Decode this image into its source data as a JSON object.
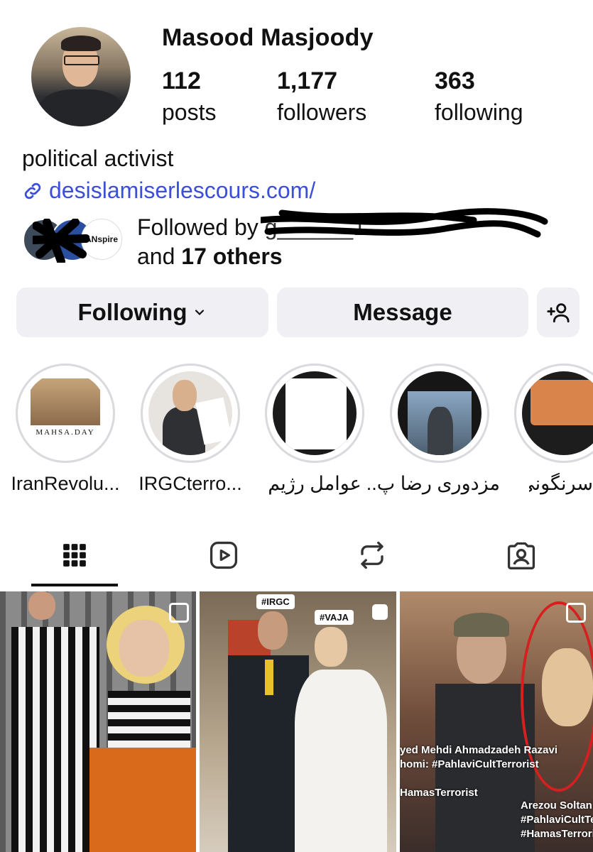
{
  "profile": {
    "name": "Masood Masjoody",
    "posts_count": "112",
    "posts_label": "posts",
    "followers_count": "1,177",
    "followers_label": "followers",
    "following_count": "363",
    "following_label": "following",
    "bio": "political activist",
    "link": "desislamiserlescours.com/"
  },
  "followed_by": {
    "prefix": "Followed by",
    "redacted_name": "g______1",
    "line2_prefix": "and ",
    "others": "17 others",
    "avatar_label": "ANspire"
  },
  "actions": {
    "following": "Following",
    "message": "Message"
  },
  "highlights": [
    {
      "label": "IranRevolu...",
      "title": "MAHSA.DAY"
    },
    {
      "label": "IRGCterro..."
    },
    {
      "label": "عوامل رژیم"
    },
    {
      "label": "مزدوری رضا پ.."
    },
    {
      "label": "سرنگونی"
    }
  ],
  "tabs": [
    "grid",
    "reels",
    "reposts",
    "tagged"
  ],
  "posts": [
    {
      "tags": []
    },
    {
      "tags": [
        "#IRGC",
        "#VAJA"
      ]
    },
    {
      "caption1": "yed Mehdi Ahmadzadeh Razavi\nhomi: #PahlaviCultTerrorist\n\nHamasTerrorist",
      "caption2": "Arezou Soltani:\n#PahlaviCultTerr\n#HamasTerrorist"
    }
  ],
  "colors": {
    "link": "#3b4fd8",
    "button_bg": "#efeff4",
    "highlight_ring": "#d9d9de"
  }
}
